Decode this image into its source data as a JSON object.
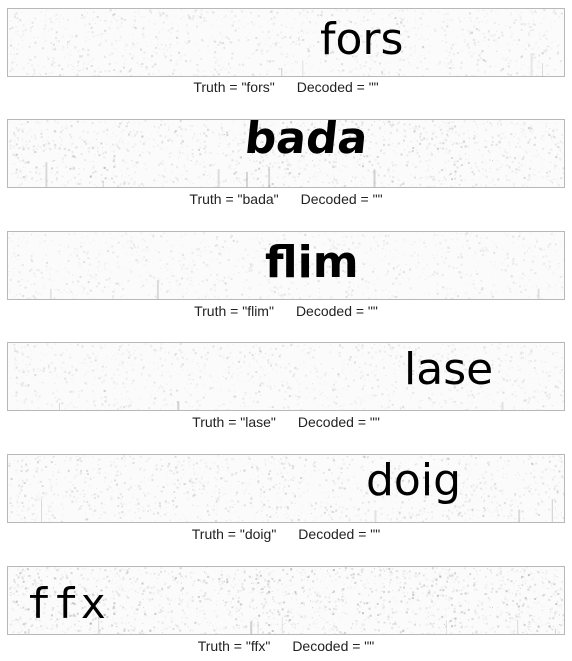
{
  "samples": [
    {
      "word": "fors",
      "caption_truth": "Truth = \"fors\"",
      "caption_decoded": "Decoded = \"\"",
      "noise_level": 0.35
    },
    {
      "word": "bada",
      "caption_truth": "Truth = \"bada\"",
      "caption_decoded": "Decoded = \"\"",
      "noise_level": 0.55
    },
    {
      "word": "flim",
      "caption_truth": "Truth = \"flim\"",
      "caption_decoded": "Decoded = \"\"",
      "noise_level": 0.25
    },
    {
      "word": "lase",
      "caption_truth": "Truth = \"lase\"",
      "caption_decoded": "Decoded = \"\"",
      "noise_level": 0.3
    },
    {
      "word": "doig",
      "caption_truth": "Truth = \"doig\"",
      "caption_decoded": "Decoded = \"\"",
      "noise_level": 0.45
    },
    {
      "word": "ffx",
      "caption_truth": "Truth = \"ffx\"",
      "caption_decoded": "Decoded = \"\"",
      "noise_level": 0.75
    }
  ]
}
